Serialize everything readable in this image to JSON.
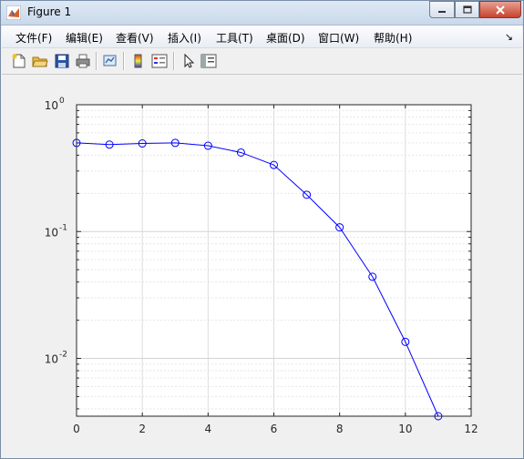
{
  "window": {
    "title": "Figure 1"
  },
  "menu": {
    "items": [
      "文件(F)",
      "编辑(E)",
      "查看(V)",
      "插入(I)",
      "工具(T)",
      "桌面(D)",
      "窗口(W)",
      "帮助(H)"
    ]
  },
  "toolbar": {
    "buttons": [
      "new-figure",
      "open-file",
      "save",
      "print",
      "link-plot",
      "insert-colorbar",
      "insert-legend",
      "edit-plot",
      "show-plot-tools"
    ]
  },
  "colors": {
    "line": "#0000ff",
    "axes_bg": "#ffffff",
    "grid": "#dcdcdc"
  },
  "chart_data": {
    "type": "line",
    "title": "",
    "xlabel": "",
    "ylabel": "",
    "yscale": "log",
    "xlim": [
      0,
      12
    ],
    "ylim": [
      0.0035,
      1
    ],
    "xticks": [
      0,
      2,
      4,
      6,
      8,
      10,
      12
    ],
    "yticks": [
      {
        "base": "10",
        "exp": "0"
      },
      {
        "base": "10",
        "exp": "-1"
      },
      {
        "base": "10",
        "exp": "-2"
      }
    ],
    "grid": true,
    "marker": "circle",
    "series": [
      {
        "x": [
          0,
          1,
          2,
          3,
          4,
          5,
          6,
          7,
          8,
          9,
          10,
          11
        ],
        "y": [
          0.5,
          0.485,
          0.495,
          0.5,
          0.475,
          0.42,
          0.335,
          0.195,
          0.108,
          0.044,
          0.0135,
          0.0035
        ]
      }
    ]
  }
}
